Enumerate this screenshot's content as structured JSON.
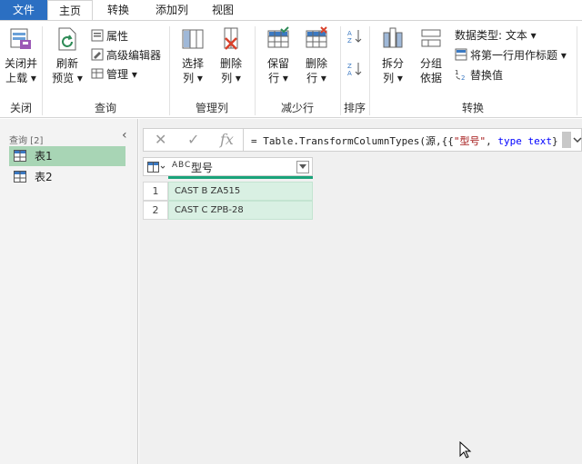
{
  "tabs": [
    "文件",
    "主页",
    "转换",
    "添加列",
    "视图"
  ],
  "ribbon": {
    "close_apply": {
      "line1": "关闭并",
      "line2": "上载 ▾"
    },
    "refresh": {
      "line1": "刷新",
      "line2": "预览 ▾"
    },
    "properties": "属性",
    "advanced_editor": "高级编辑器",
    "manage": "管理 ▾",
    "choose_cols": {
      "line1": "选择",
      "line2": "列 ▾"
    },
    "remove_cols": {
      "line1": "删除",
      "line2": "列 ▾"
    },
    "keep_rows": {
      "line1": "保留",
      "line2": "行 ▾"
    },
    "remove_rows": {
      "line1": "删除",
      "line2": "行 ▾"
    },
    "split_col": {
      "line1": "拆分",
      "line2": "列 ▾"
    },
    "group_by": {
      "line1": "分组",
      "line2": "依据"
    },
    "data_type": "数据类型: 文本 ▾",
    "first_row_header": "将第一行用作标题 ▾",
    "replace_values": "替换值",
    "groups": {
      "close": "关闭",
      "query": "查询",
      "manage_cols": "管理列",
      "reduce_rows": "减少行",
      "sort": "排序",
      "transform": "转换"
    }
  },
  "queries": {
    "header": "查询 [2]",
    "items": [
      "表1",
      "表2"
    ]
  },
  "formula": {
    "prefix": "= Table.TransformColumnTypes(源,{{",
    "string": "\"型号\"",
    "sep": ", ",
    "keyword": "type text",
    "suffix": "}"
  },
  "table": {
    "type_label": "A B C",
    "column": "型号",
    "rows": [
      {
        "num": "1",
        "value": "CAST B ZA515"
      },
      {
        "num": "2",
        "value": "CAST C ZPB-28"
      }
    ]
  }
}
